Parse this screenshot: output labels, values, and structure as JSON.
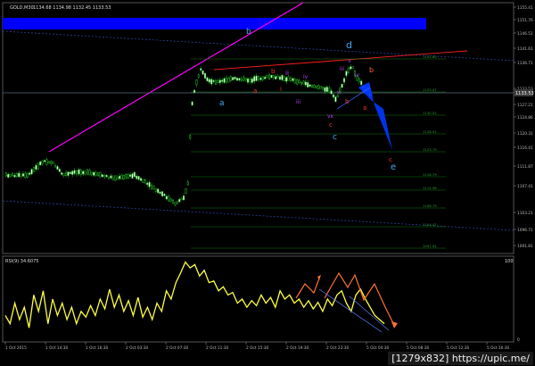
{
  "header": {
    "symbol_label": "GOLD,M30",
    "ohlc_values": "1134.68 1134.98 1132.45 1133.53",
    "rsi_label": "RSI(9) 34.6075",
    "rsi_max_label": "100"
  },
  "watermark": "[1279x832] https://upic.me/",
  "chart_data": [
    {
      "type": "line",
      "title": "GOLD,M30",
      "y_ticks": [
        "1155.41",
        "1151.76",
        "1146.51",
        "1141.61",
        "1136.71",
        "1133.53",
        "1127.21",
        "1124.86",
        "1120.31",
        "1116.41",
        "1111.87",
        "1107.41",
        "1103.21",
        "1096.71",
        "1091.81"
      ],
      "x_ticks": [
        "1 Oct 2015",
        "1 Oct 14:30",
        "1 Oct 16:30",
        "2 Oct 03:30",
        "2 Oct 07:30",
        "2 Oct 11:30",
        "2 Oct 15:30",
        "2 Oct 19:30",
        "2 Oct 23:30",
        "5 Oct 04:30",
        "5 Oct 08:30",
        "5 Oct 12:30",
        "5 Oct 16:30"
      ],
      "current_price": "1133.53",
      "fib_levels": [
        "1141.65",
        "1133.47",
        "1130.52",
        "1126.51",
        "1123.75",
        "1118.79",
        "1112.98",
        "1108.79",
        "1104.47",
        "1097.54"
      ],
      "wave_labels": [
        {
          "text": "b",
          "color": "#3fa9f5"
        },
        {
          "text": "a",
          "color": "#3fa9f5"
        },
        {
          "text": "d",
          "color": "#3fa9f5"
        },
        {
          "text": "c",
          "color": "#3fa9f5"
        },
        {
          "text": "e",
          "color": "#3fa9f5"
        },
        {
          "text": "a",
          "color": "#ff3030"
        },
        {
          "text": "b",
          "color": "#ff3030"
        },
        {
          "text": "c",
          "color": "#ff3030"
        },
        {
          "text": "a",
          "color": "#ff3030"
        },
        {
          "text": "b",
          "color": "#ff3030"
        },
        {
          "text": "b",
          "color": "#ff6a30"
        },
        {
          "text": "c",
          "color": "#ff3030"
        },
        {
          "text": "i",
          "color": "#ff3030"
        },
        {
          "text": "ii",
          "color": "#c040ff"
        },
        {
          "text": "iii",
          "color": "#c040ff"
        },
        {
          "text": "iv",
          "color": "#c040ff"
        },
        {
          "text": "v",
          "color": "#c040ff"
        },
        {
          "text": "vx",
          "color": "#c040ff"
        },
        {
          "text": "iii",
          "color": "#c040ff"
        },
        {
          "text": "iv",
          "color": "#c040ff"
        },
        {
          "text": "v",
          "color": "#c040ff"
        }
      ]
    },
    {
      "type": "line",
      "title": "RSI(9) 34.6075",
      "ylim": [
        0,
        100
      ],
      "y_ticks": [
        "100",
        "0"
      ]
    }
  ]
}
